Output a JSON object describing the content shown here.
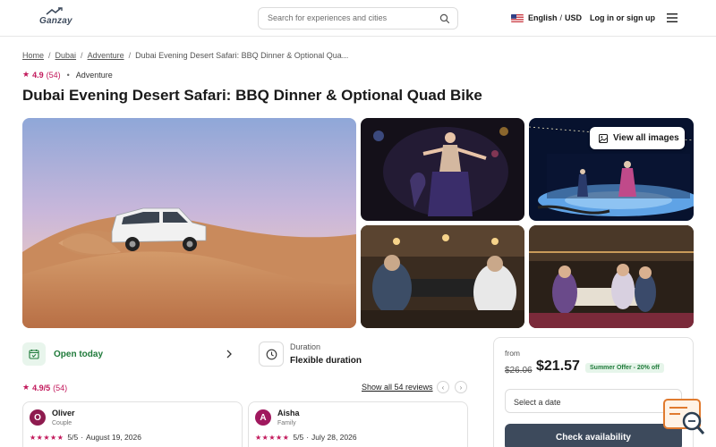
{
  "header": {
    "logo_text": "Ganzay",
    "search_placeholder": "Search for experiences and cities",
    "language": "English",
    "currency": "USD",
    "login_label": "Log in or sign up"
  },
  "breadcrumb": {
    "items": [
      "Home",
      "Dubai",
      "Adventure"
    ],
    "current": "Dubai Evening Desert Safari: BBQ Dinner & Optional Qua..."
  },
  "summary": {
    "rating": "4.9",
    "rating_count": "(54)",
    "category": "Adventure",
    "title": "Dubai Evening Desert Safari: BBQ Dinner & Optional Quad Bike"
  },
  "gallery": {
    "view_all_label": "View all images"
  },
  "info": {
    "open_label": "Open today",
    "duration_label": "Duration",
    "duration_value": "Flexible duration"
  },
  "reviews": {
    "rating": "4.9/5",
    "count": "(54)",
    "show_all_label": "Show all 54 reviews",
    "items": [
      {
        "initial": "O",
        "name": "Oliver",
        "type": "Couple",
        "score": "5/5",
        "date": "August 19, 2026",
        "avatar_color": "#8e1b4f"
      },
      {
        "initial": "A",
        "name": "Aisha",
        "type": "Family",
        "score": "5/5",
        "date": "July 28, 2026",
        "avatar_color": "#a0185e"
      }
    ]
  },
  "booking": {
    "from_label": "from",
    "old_price": "$26.06",
    "price": "$21.57",
    "offer": "Summer Offer - 20% off",
    "date_placeholder": "Select a date",
    "cta_label": "Check availability"
  },
  "colors": {
    "accent": "#c2185b",
    "brand_dark": "#3d4a5c",
    "success": "#1f7a3a"
  }
}
